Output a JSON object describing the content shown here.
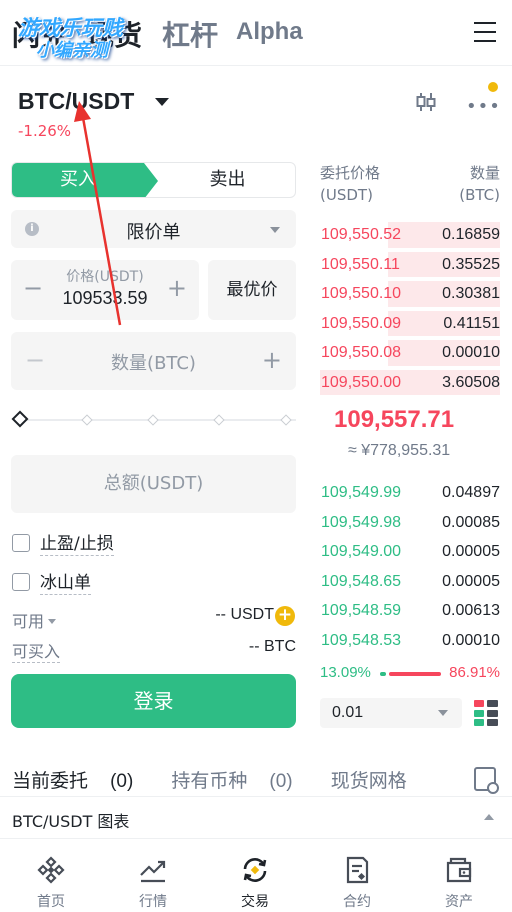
{
  "top_tabs": [
    "闪兑",
    "现货",
    "杠杆",
    "Alpha"
  ],
  "watermark": {
    "line1": "游戏乐玩贱",
    "line2": "小编亲测"
  },
  "pair": {
    "symbol": "BTC/USDT",
    "change": "-1.26%"
  },
  "trade": {
    "buy_label": "买入",
    "sell_label": "卖出",
    "order_type": "限价单",
    "price_label": "价格(USDT)",
    "price_value": "109533.59",
    "best_price": "最优价",
    "qty_placeholder": "数量(BTC)",
    "total_placeholder": "总额(USDT)",
    "tp_sl": "止盈/止损",
    "iceberg": "冰山单",
    "available_label": "可用",
    "available_value": "-- USDT",
    "canbuy_label": "可买入",
    "canbuy_value": "-- BTC",
    "login": "登录",
    "slider_percent": 0
  },
  "orderbook": {
    "h_price": "委托价格",
    "h_price_unit": "(USDT)",
    "h_qty": "数量",
    "h_qty_unit": "(BTC)",
    "asks": [
      {
        "price": "109,550.52",
        "qty": "0.16859",
        "depth": 0.62
      },
      {
        "price": "109,550.11",
        "qty": "0.35525",
        "depth": 0.62
      },
      {
        "price": "109,550.10",
        "qty": "0.30381",
        "depth": 0.62
      },
      {
        "price": "109,550.09",
        "qty": "0.41151",
        "depth": 0.62
      },
      {
        "price": "109,550.08",
        "qty": "0.00010",
        "depth": 0.62
      },
      {
        "price": "109,550.00",
        "qty": "3.60508",
        "depth": 1.0
      }
    ],
    "mid_price": "109,557.71",
    "mid_cny": "≈ ¥778,955.31",
    "bids": [
      {
        "price": "109,549.99",
        "qty": "0.04897"
      },
      {
        "price": "109,549.98",
        "qty": "0.00085"
      },
      {
        "price": "109,549.00",
        "qty": "0.00005"
      },
      {
        "price": "109,548.65",
        "qty": "0.00005"
      },
      {
        "price": "109,548.59",
        "qty": "0.00613"
      },
      {
        "price": "109,548.53",
        "qty": "0.00010"
      }
    ],
    "buy_ratio": "13.09%",
    "sell_ratio": "86.91%",
    "depth_step": "0.01"
  },
  "order_tabs": {
    "current": "当前委托",
    "current_count": "(0)",
    "holdings": "持有币种",
    "holdings_count": "(0)",
    "grid": "现货网格"
  },
  "chart_bar": "BTC/USDT 图表",
  "bottom_nav": [
    "首页",
    "行情",
    "交易",
    "合约",
    "资产"
  ],
  "colors": {
    "green": "#2ebd85",
    "red": "#f6465d",
    "yellow": "#f0b90b"
  }
}
